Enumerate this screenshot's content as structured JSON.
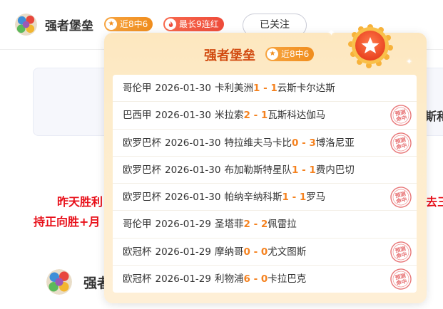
{
  "header": {
    "name": "强者堡垒",
    "hit_badge": "近8中6",
    "streak_badge": "最长9连红",
    "follow_label": "已关注"
  },
  "background": {
    "card_fragment": "斯和",
    "red_line_1": "昨天胜利",
    "red_line_2": "持正向胜+月",
    "red_line_3": "去三",
    "second_name": "强者"
  },
  "popup": {
    "title": "强者堡垒",
    "badge": "近8中6",
    "stamp_text": "预测命中",
    "matches": [
      {
        "league": "哥伦甲",
        "date": "2026-01-30",
        "home": "卡利美洲",
        "home_score": "1",
        "sep": "-",
        "away_score": "1",
        "away": "云斯卡尔达斯",
        "hit": false
      },
      {
        "league": "巴西甲",
        "date": "2026-01-30",
        "home": "米拉索",
        "home_score": "2",
        "sep": "-",
        "away_score": "1",
        "away": "瓦斯科达伽马",
        "hit": true
      },
      {
        "league": "欧罗巴杯",
        "date": "2026-01-30",
        "home": "特拉维夫马卡比",
        "home_score": "0",
        "sep": "-",
        "away_score": "3",
        "away": "博洛尼亚",
        "hit": true
      },
      {
        "league": "欧罗巴杯",
        "date": "2026-01-30",
        "home": "布加勒斯特星队",
        "home_score": "1",
        "sep": "-",
        "away_score": "1",
        "away": "费内巴切",
        "hit": false
      },
      {
        "league": "欧罗巴杯",
        "date": "2026-01-30",
        "home": "帕纳辛纳科斯",
        "home_score": "1",
        "sep": "-",
        "away_score": "1",
        "away": "罗马",
        "hit": true
      },
      {
        "league": "哥伦甲",
        "date": "2026-01-29",
        "home": "圣塔菲",
        "home_score": "2",
        "sep": "-",
        "away_score": "2",
        "away": "佩雷拉",
        "hit": false
      },
      {
        "league": "欧冠杯",
        "date": "2026-01-29",
        "home": "摩纳哥",
        "home_score": "0",
        "sep": "-",
        "away_score": "0",
        "away": "尤文图斯",
        "hit": true
      },
      {
        "league": "欧冠杯",
        "date": "2026-01-29",
        "home": "利物浦",
        "home_score": "6",
        "sep": "-",
        "away_score": "0",
        "away": "卡拉巴克",
        "hit": true
      }
    ]
  },
  "colors": {
    "accent_orange": "#f5821f",
    "title_red": "#d24c12",
    "alert_red": "#e8101a",
    "stamp_red": "#e0484a"
  },
  "icons": {
    "hit_badge": "star-icon",
    "streak_badge": "flame-icon",
    "medal": "medal-star-icon",
    "stamp": "hit-stamp-icon"
  }
}
